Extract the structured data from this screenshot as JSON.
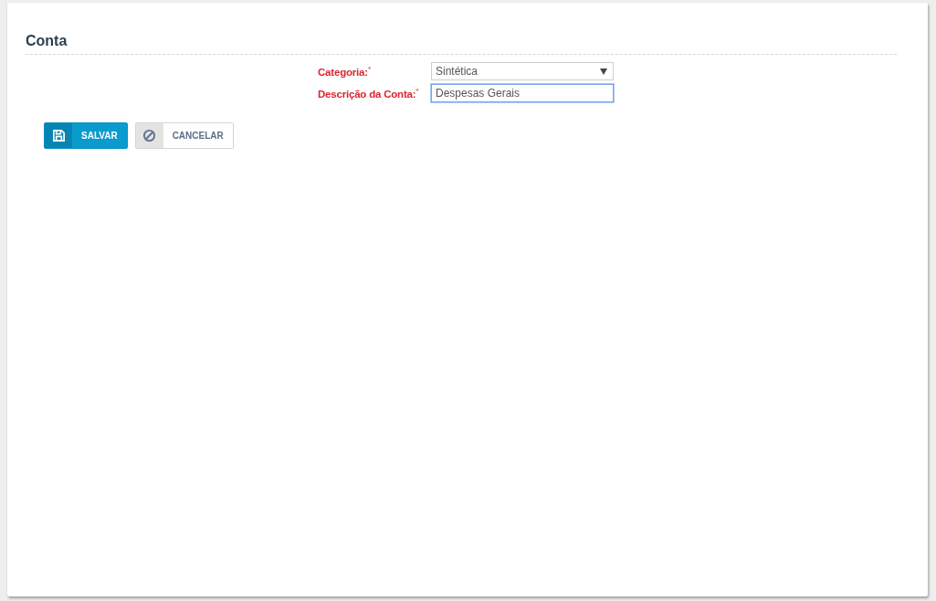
{
  "section": {
    "title": "Conta"
  },
  "fields": [
    {
      "kind": "select",
      "label": "Categoria:",
      "required_mark": "*",
      "value": "Sintética",
      "focused": false
    },
    {
      "kind": "text",
      "label": "Descrição da Conta:",
      "required_mark": "*",
      "value": "Despesas Gerais",
      "focused": true
    }
  ],
  "buttons": [
    {
      "kind": "save",
      "label": "SALVAR"
    },
    {
      "kind": "cancel",
      "label": "CANCELAR"
    }
  ]
}
